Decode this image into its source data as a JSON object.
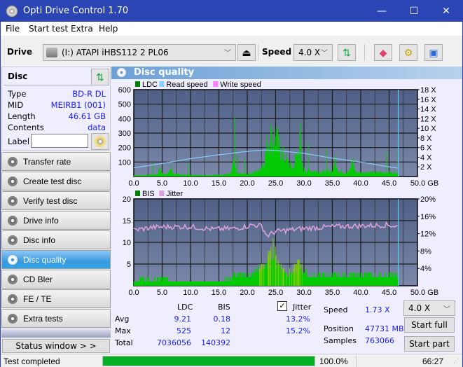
{
  "window": {
    "title": "Opti Drive Control 1.70",
    "minimize": "—",
    "maximize": "☐",
    "close": "✕"
  },
  "menu": [
    "File",
    "Start test",
    "Extra",
    "Help"
  ],
  "toolbar": {
    "drive_label": "Drive",
    "drive_value": "(I:)  ATAPI iHBS112   2 PL06",
    "speed_label": "Speed",
    "speed_value": "4.0 X"
  },
  "disc": {
    "header": "Disc",
    "rows": [
      {
        "key": "Type",
        "value": "BD-R DL"
      },
      {
        "key": "MID",
        "value": "MEIRB1 (001)"
      },
      {
        "key": "Length",
        "value": "46.61 GB"
      },
      {
        "key": "Contents",
        "value": "data"
      }
    ],
    "label_key": "Label",
    "label_value": ""
  },
  "nav": [
    {
      "label": "Transfer rate",
      "active": false
    },
    {
      "label": "Create test disc",
      "active": false
    },
    {
      "label": "Verify test disc",
      "active": false
    },
    {
      "label": "Drive info",
      "active": false
    },
    {
      "label": "Disc info",
      "active": false
    },
    {
      "label": "Disc quality",
      "active": true
    },
    {
      "label": "CD Bler",
      "active": false
    },
    {
      "label": "FE / TE",
      "active": false
    },
    {
      "label": "Extra tests",
      "active": false
    }
  ],
  "status_window_button": "Status window > >",
  "panel_title": "Disc quality",
  "chart_data": [
    {
      "type": "bar",
      "title": "LDC",
      "legend": [
        {
          "name": "LDC",
          "color": "#008000"
        },
        {
          "name": "Read speed",
          "color": "#87cefa"
        },
        {
          "name": "Write speed",
          "color": "#ff80ff"
        }
      ],
      "xlabel": "GB",
      "x_ticks": [
        "0.0",
        "5.0",
        "10.0",
        "15.0",
        "20.0",
        "25.0",
        "30.0",
        "35.0",
        "40.0",
        "45.0",
        "50.0 GB"
      ],
      "xlim": [
        0,
        50
      ],
      "ylim_left": [
        0,
        600
      ],
      "y_ticks_left": [
        "100",
        "200",
        "300",
        "400",
        "500",
        "600"
      ],
      "ylim_right": [
        0,
        18
      ],
      "y_ticks_right": [
        "2 X",
        "4 X",
        "6 X",
        "8 X",
        "10 X",
        "12 X",
        "14 X",
        "16 X",
        "18 X"
      ],
      "end_marker_gb": 46.61,
      "ldc_profile": [
        [
          0,
          15
        ],
        [
          1,
          10
        ],
        [
          2,
          12
        ],
        [
          3,
          18
        ],
        [
          4,
          20
        ],
        [
          4.6,
          90
        ],
        [
          5,
          25
        ],
        [
          6,
          30
        ],
        [
          6.5,
          90
        ],
        [
          7,
          20
        ],
        [
          8,
          22
        ],
        [
          9,
          18
        ],
        [
          10,
          15
        ],
        [
          11,
          12
        ],
        [
          12,
          15
        ],
        [
          13,
          12
        ],
        [
          14,
          15
        ],
        [
          15,
          18
        ],
        [
          16,
          20
        ],
        [
          17,
          25
        ],
        [
          17.6,
          150
        ],
        [
          18,
          40
        ],
        [
          19,
          25
        ],
        [
          20,
          30
        ],
        [
          21,
          40
        ],
        [
          22,
          60
        ],
        [
          22.5,
          120
        ],
        [
          23,
          170
        ],
        [
          23.5,
          350
        ],
        [
          24,
          420
        ],
        [
          24.5,
          380
        ],
        [
          25,
          420
        ],
        [
          25.5,
          300
        ],
        [
          26,
          250
        ],
        [
          26.5,
          200
        ],
        [
          27,
          150
        ],
        [
          28,
          80
        ],
        [
          28.5,
          200
        ],
        [
          29,
          250
        ],
        [
          29.2,
          525
        ],
        [
          29.5,
          120
        ],
        [
          30,
          70
        ],
        [
          31,
          60
        ],
        [
          32,
          55
        ],
        [
          33,
          50
        ],
        [
          34,
          50
        ],
        [
          35,
          60
        ],
        [
          35.5,
          180
        ],
        [
          36,
          50
        ],
        [
          37,
          45
        ],
        [
          38,
          50
        ],
        [
          38.5,
          180
        ],
        [
          39,
          45
        ],
        [
          40,
          40
        ],
        [
          41,
          45
        ],
        [
          42,
          40
        ],
        [
          43,
          40
        ],
        [
          44,
          45
        ],
        [
          45,
          40
        ],
        [
          46,
          40
        ],
        [
          46.6,
          50
        ]
      ],
      "read_speed_profile": [
        [
          0,
          1.8
        ],
        [
          5,
          2.7
        ],
        [
          10,
          3.7
        ],
        [
          15,
          4.5
        ],
        [
          20,
          5.2
        ],
        [
          23,
          5.5
        ],
        [
          25,
          5.4
        ],
        [
          30,
          4.8
        ],
        [
          35,
          3.8
        ],
        [
          40,
          3.0
        ],
        [
          45,
          2.0
        ],
        [
          46.61,
          1.73
        ]
      ]
    },
    {
      "type": "bar",
      "title": "BIS",
      "legend": [
        {
          "name": "BIS",
          "color": "#008000"
        },
        {
          "name": "Jitter",
          "color": "#dda0dd"
        }
      ],
      "xlabel": "GB",
      "x_ticks": [
        "0.0",
        "5.0",
        "10.0",
        "15.0",
        "20.0",
        "25.0",
        "30.0",
        "35.0",
        "40.0",
        "45.0",
        "50.0 GB"
      ],
      "xlim": [
        0,
        50
      ],
      "ylim_left": [
        0,
        20
      ],
      "y_ticks_left": [
        "5",
        "10",
        "15",
        "20"
      ],
      "ylim_right": [
        0,
        20
      ],
      "y_ticks_right": [
        "4%",
        "8%",
        "12%",
        "16%",
        "20%"
      ],
      "end_marker_gb": 46.61,
      "bis_profile": [
        [
          0,
          1
        ],
        [
          1,
          2
        ],
        [
          2,
          2
        ],
        [
          3,
          1.5
        ],
        [
          4,
          2
        ],
        [
          5,
          2
        ],
        [
          6,
          2
        ],
        [
          7,
          1.5
        ],
        [
          8,
          1.5
        ],
        [
          9,
          1.5
        ],
        [
          10,
          1.5
        ],
        [
          11,
          1.5
        ],
        [
          12,
          1.5
        ],
        [
          13,
          1.5
        ],
        [
          14,
          1.5
        ],
        [
          15,
          1.5
        ],
        [
          16,
          2
        ],
        [
          17,
          2
        ],
        [
          17.5,
          4
        ],
        [
          18,
          3
        ],
        [
          19,
          3
        ],
        [
          20,
          3
        ],
        [
          21,
          4
        ],
        [
          22,
          5
        ],
        [
          23,
          6
        ],
        [
          24,
          9
        ],
        [
          24.5,
          12
        ],
        [
          25,
          8
        ],
        [
          26,
          5
        ],
        [
          27,
          4
        ],
        [
          28,
          4
        ],
        [
          29,
          7
        ],
        [
          30,
          4
        ],
        [
          31,
          3
        ],
        [
          32,
          3
        ],
        [
          33,
          3
        ],
        [
          34,
          3
        ],
        [
          35,
          3
        ],
        [
          36,
          3
        ],
        [
          37,
          3
        ],
        [
          38,
          3
        ],
        [
          39,
          3
        ],
        [
          40,
          3
        ],
        [
          41,
          3
        ],
        [
          42,
          3
        ],
        [
          43,
          3
        ],
        [
          44,
          3
        ],
        [
          45,
          3
        ],
        [
          46,
          3
        ],
        [
          46.6,
          3
        ]
      ],
      "jitter_profile": [
        [
          0,
          12.8
        ],
        [
          3,
          13.4
        ],
        [
          6,
          13.6
        ],
        [
          10,
          13.6
        ],
        [
          14,
          13.0
        ],
        [
          18,
          13.2
        ],
        [
          21,
          14.0
        ],
        [
          22.5,
          13.8
        ],
        [
          23.5,
          11.5
        ],
        [
          25,
          12.5
        ],
        [
          30,
          13.2
        ],
        [
          35,
          13.6
        ],
        [
          40,
          13.8
        ],
        [
          45,
          14.0
        ],
        [
          46.61,
          13.6
        ]
      ]
    }
  ],
  "stats": {
    "col_ldc": "LDC",
    "col_bis": "BIS",
    "jitter_checkbox": "Jitter",
    "jitter_checked": true,
    "rows": [
      {
        "label": "Avg",
        "ldc": "9.21",
        "bis": "0.18",
        "jitter": "13.2%"
      },
      {
        "label": "Max",
        "ldc": "525",
        "bis": "12",
        "jitter": "15.2%"
      },
      {
        "label": "Total",
        "ldc": "7036056",
        "bis": "140392",
        "jitter": ""
      }
    ],
    "speed_label": "Speed",
    "speed_value": "1.73 X",
    "position_label": "Position",
    "position_value": "47731 MB",
    "samples_label": "Samples",
    "samples_value": "763066",
    "speed_select": "4.0 X",
    "start_full": "Start full",
    "start_part": "Start part"
  },
  "statusbar": {
    "text": "Test completed",
    "progress": 1.0,
    "progress_text": "100.0%",
    "time": "66:27"
  }
}
